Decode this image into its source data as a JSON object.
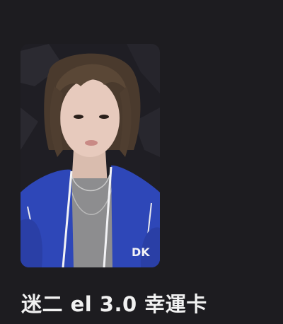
{
  "product": {
    "title": "迷二 el 3.0 幸運卡"
  },
  "photo": {
    "subject": "person-photo",
    "jersey_text": "DK"
  },
  "colors": {
    "background": "#1d1c20",
    "title_text": "#f1f1f1",
    "jersey": "#2e47b8"
  }
}
